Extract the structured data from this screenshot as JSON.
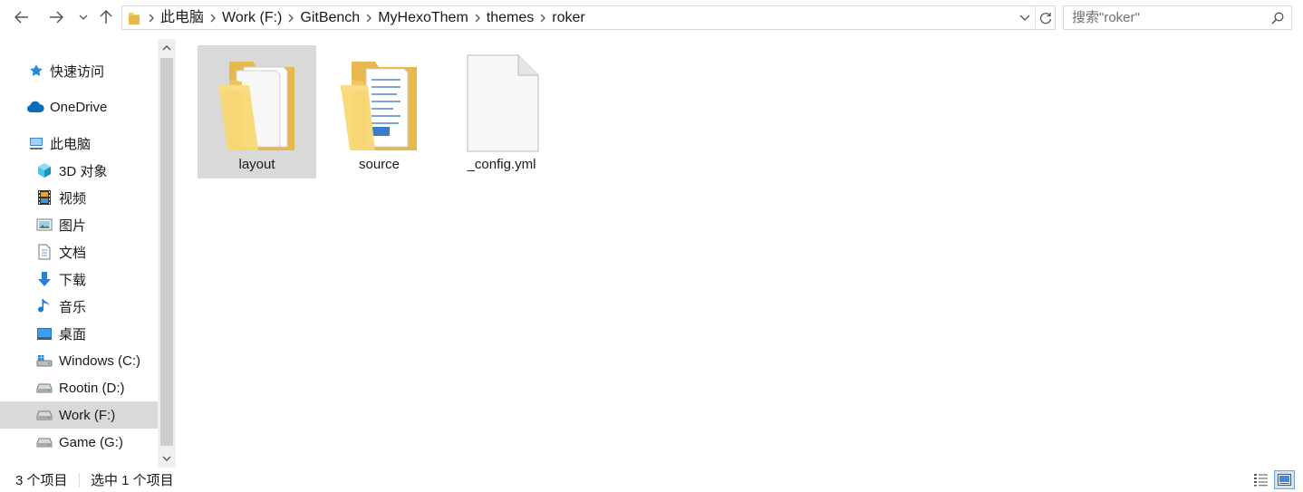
{
  "address": {
    "breadcrumb": [
      "此电脑",
      "Work (F:)",
      "GitBench",
      "MyHexoThem",
      "themes",
      "roker"
    ]
  },
  "search": {
    "placeholder": "搜索\"roker\""
  },
  "sidebar": {
    "items": [
      {
        "label": "快速访问",
        "icon": "star-icon"
      },
      {
        "label": "OneDrive",
        "icon": "cloud-icon"
      },
      {
        "label": "此电脑",
        "icon": "computer-icon"
      },
      {
        "label": "3D 对象",
        "icon": "cube-icon"
      },
      {
        "label": "视频",
        "icon": "film-icon"
      },
      {
        "label": "图片",
        "icon": "picture-icon"
      },
      {
        "label": "文档",
        "icon": "document-icon"
      },
      {
        "label": "下载",
        "icon": "download-arrow-icon"
      },
      {
        "label": "音乐",
        "icon": "music-note-icon"
      },
      {
        "label": "桌面",
        "icon": "desktop-icon"
      },
      {
        "label": "Windows (C:)",
        "icon": "windows-drive-icon"
      },
      {
        "label": "Rootin (D:)",
        "icon": "drive-icon"
      },
      {
        "label": "Work (F:)",
        "icon": "drive-icon",
        "selected": true
      },
      {
        "label": "Game (G:)",
        "icon": "drive-icon"
      }
    ]
  },
  "files": [
    {
      "name": "layout",
      "type": "folder",
      "selected": true
    },
    {
      "name": "source",
      "type": "folder"
    },
    {
      "name": "_config.yml",
      "type": "file"
    }
  ],
  "status": {
    "item_count": "3 个项目",
    "selected_count": "选中 1 个项目"
  },
  "colors": {
    "selection": "#d9d9d9",
    "folder": "#f6cf6a",
    "accent": "#0078d7"
  }
}
